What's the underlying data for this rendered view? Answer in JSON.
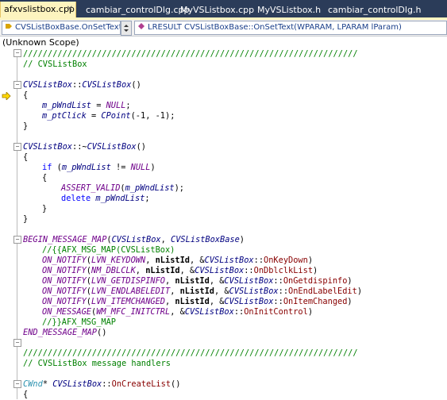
{
  "tabs": [
    {
      "label": "afxvslistbox.cpp",
      "active": true
    },
    {
      "label": "cambiar_controlDlg.cpp",
      "active": false
    },
    {
      "label": "MyVSListbox.cpp",
      "active": false
    },
    {
      "label": "MyVSListbox.h",
      "active": false
    },
    {
      "label": "cambiar_controlDlg.h",
      "active": false
    }
  ],
  "navbar": {
    "scope_combo": "CVSListBoxBase.OnSetText",
    "member_combo": "LRESULT CVSListBoxBase::OnSetText(WPARAM, LPARAM lParam)"
  },
  "scope_label": "(Unknown Scope)",
  "code": {
    "l0": "////////////////////////////////////////////////////////////////////",
    "l1": "// CVSListBox",
    "l3a": "CVSListBox",
    "l3b": "::",
    "l3c": "CVSListBox",
    "l3d": "()",
    "l4": "{",
    "l5a": "m_pWndList",
    "l5b": " = ",
    "l5c": "NULL",
    "l5d": ";",
    "l6a": "m_ptClick",
    "l6b": " = ",
    "l6c": "CPoint",
    "l6d": "(-1, -1);",
    "l7": "}",
    "l9a": "CVSListBox",
    "l9b": "::~",
    "l9c": "CVSListBox",
    "l9d": "()",
    "l10": "{",
    "l11a": "if",
    "l11b": " (",
    "l11c": "m_pWndList",
    "l11d": " != ",
    "l11e": "NULL",
    "l11f": ")",
    "l12": "{",
    "l13a": "ASSERT_VALID",
    "l13b": "(",
    "l13c": "m_pWndList",
    "l13d": ");",
    "l14a": "delete",
    "l14b": " ",
    "l14c": "m_pWndList",
    "l14d": ";",
    "l15": "}",
    "l16": "}",
    "l18a": "BEGIN_MESSAGE_MAP",
    "l18b": "(",
    "l18c": "CVSListBox",
    "l18d": ", ",
    "l18e": "CVSListBoxBase",
    "l18f": ")",
    "l19": "//{{AFX_MSG_MAP(CVSListBox)",
    "l20a": "ON_NOTIFY",
    "l20b": "(",
    "l20c": "LVN_KEYDOWN",
    "l20d": ", ",
    "l20e": "nListId",
    "l20f": ", &",
    "l20g": "CVSListBox",
    "l20h": "::",
    "l20i": "OnKeyDown",
    "l20j": ")",
    "l21c": "NM_DBLCLK",
    "l21i": "OnDblclkList",
    "l22c": "LVN_GETDISPINFO",
    "l22i": "OnGetdispinfo",
    "l23c": "LVN_ENDLABELEDIT",
    "l23i": "OnEndLabelEdit",
    "l24c": "LVN_ITEMCHANGED",
    "l24i": "OnItemChanged",
    "l25a": "ON_MESSAGE",
    "l25c": "WM_MFC_INITCTRL",
    "l25i": "OnInitControl",
    "l26": "//}}AFX_MSG_MAP",
    "l27a": "END_MESSAGE_MAP",
    "l27b": "()",
    "l29": "////////////////////////////////////////////////////////////////////",
    "l30": "// CVSListBox message handlers",
    "l32a": "CWnd",
    "l32b": "* ",
    "l32c": "CVSListBox",
    "l32d": "::",
    "l32e": "OnCreateList",
    "l32f": "()",
    "l33": "{"
  },
  "colors": {
    "tab_bar": "#2b3c59",
    "active_tab": "#fdf4bf",
    "comment": "#008000",
    "keyword": "#0000ff",
    "type": "#2b91af",
    "macro": "#6f008a"
  },
  "icons": {
    "current_line_marker": "yellow-arrow-icon",
    "tab_close": "close-icon"
  }
}
